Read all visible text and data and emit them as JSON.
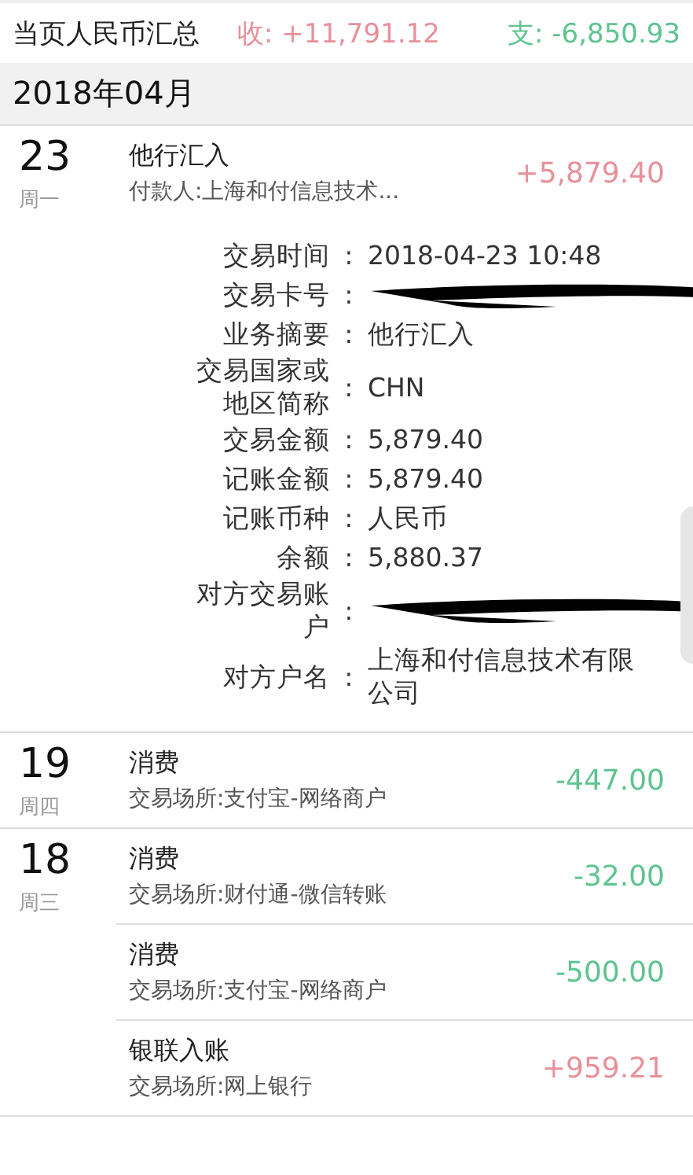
{
  "summary": {
    "label": "当页人民币汇总",
    "income": "收: +11,791.12",
    "expense": "支: -6,850.93"
  },
  "month": "2018年04月",
  "days": [
    {
      "day": "23",
      "weekday": "周一",
      "transactions": [
        {
          "title": "他行汇入",
          "subtitle": "付款人:上海和付信息技术...",
          "amount": "+5,879.40",
          "kind": "income",
          "expanded": true,
          "details": [
            {
              "label": "交易时间",
              "separator": ":",
              "value": "2018-04-23 10:48",
              "kind": "text"
            },
            {
              "label": "交易卡号",
              "separator": ":",
              "kind": "redacted"
            },
            {
              "label": "业务摘要",
              "separator": ":",
              "value": "他行汇入",
              "kind": "text"
            },
            {
              "label": "交易国家或地区简称",
              "separator": ":",
              "value": "CHN",
              "kind": "text"
            },
            {
              "label": "交易金额",
              "separator": ":",
              "value": "5,879.40",
              "kind": "text"
            },
            {
              "label": "记账金额",
              "separator": ":",
              "value": "5,879.40",
              "kind": "text"
            },
            {
              "label": "记账币种",
              "separator": ":",
              "value": "人民币",
              "kind": "text"
            },
            {
              "label": "余额",
              "separator": ":",
              "value": "5,880.37",
              "kind": "text"
            },
            {
              "label": "对方交易账户",
              "separator": ":",
              "kind": "redacted"
            },
            {
              "label": "对方户名",
              "separator": ":",
              "value": "上海和付信息技术有限公司",
              "kind": "text"
            }
          ]
        }
      ]
    },
    {
      "day": "19",
      "weekday": "周四",
      "transactions": [
        {
          "title": "消费",
          "subtitle": "交易场所:支付宝-网络商户",
          "amount": "-447.00",
          "kind": "expense"
        }
      ]
    },
    {
      "day": "18",
      "weekday": "周三",
      "transactions": [
        {
          "title": "消费",
          "subtitle": "交易场所:财付通-微信转账",
          "amount": "-32.00",
          "kind": "expense"
        },
        {
          "title": "消费",
          "subtitle": "交易场所:支付宝-网络商户",
          "amount": "-500.00",
          "kind": "expense"
        },
        {
          "title": "银联入账",
          "subtitle": "交易场所:网上银行",
          "amount": "+959.21",
          "kind": "income"
        }
      ]
    }
  ]
}
